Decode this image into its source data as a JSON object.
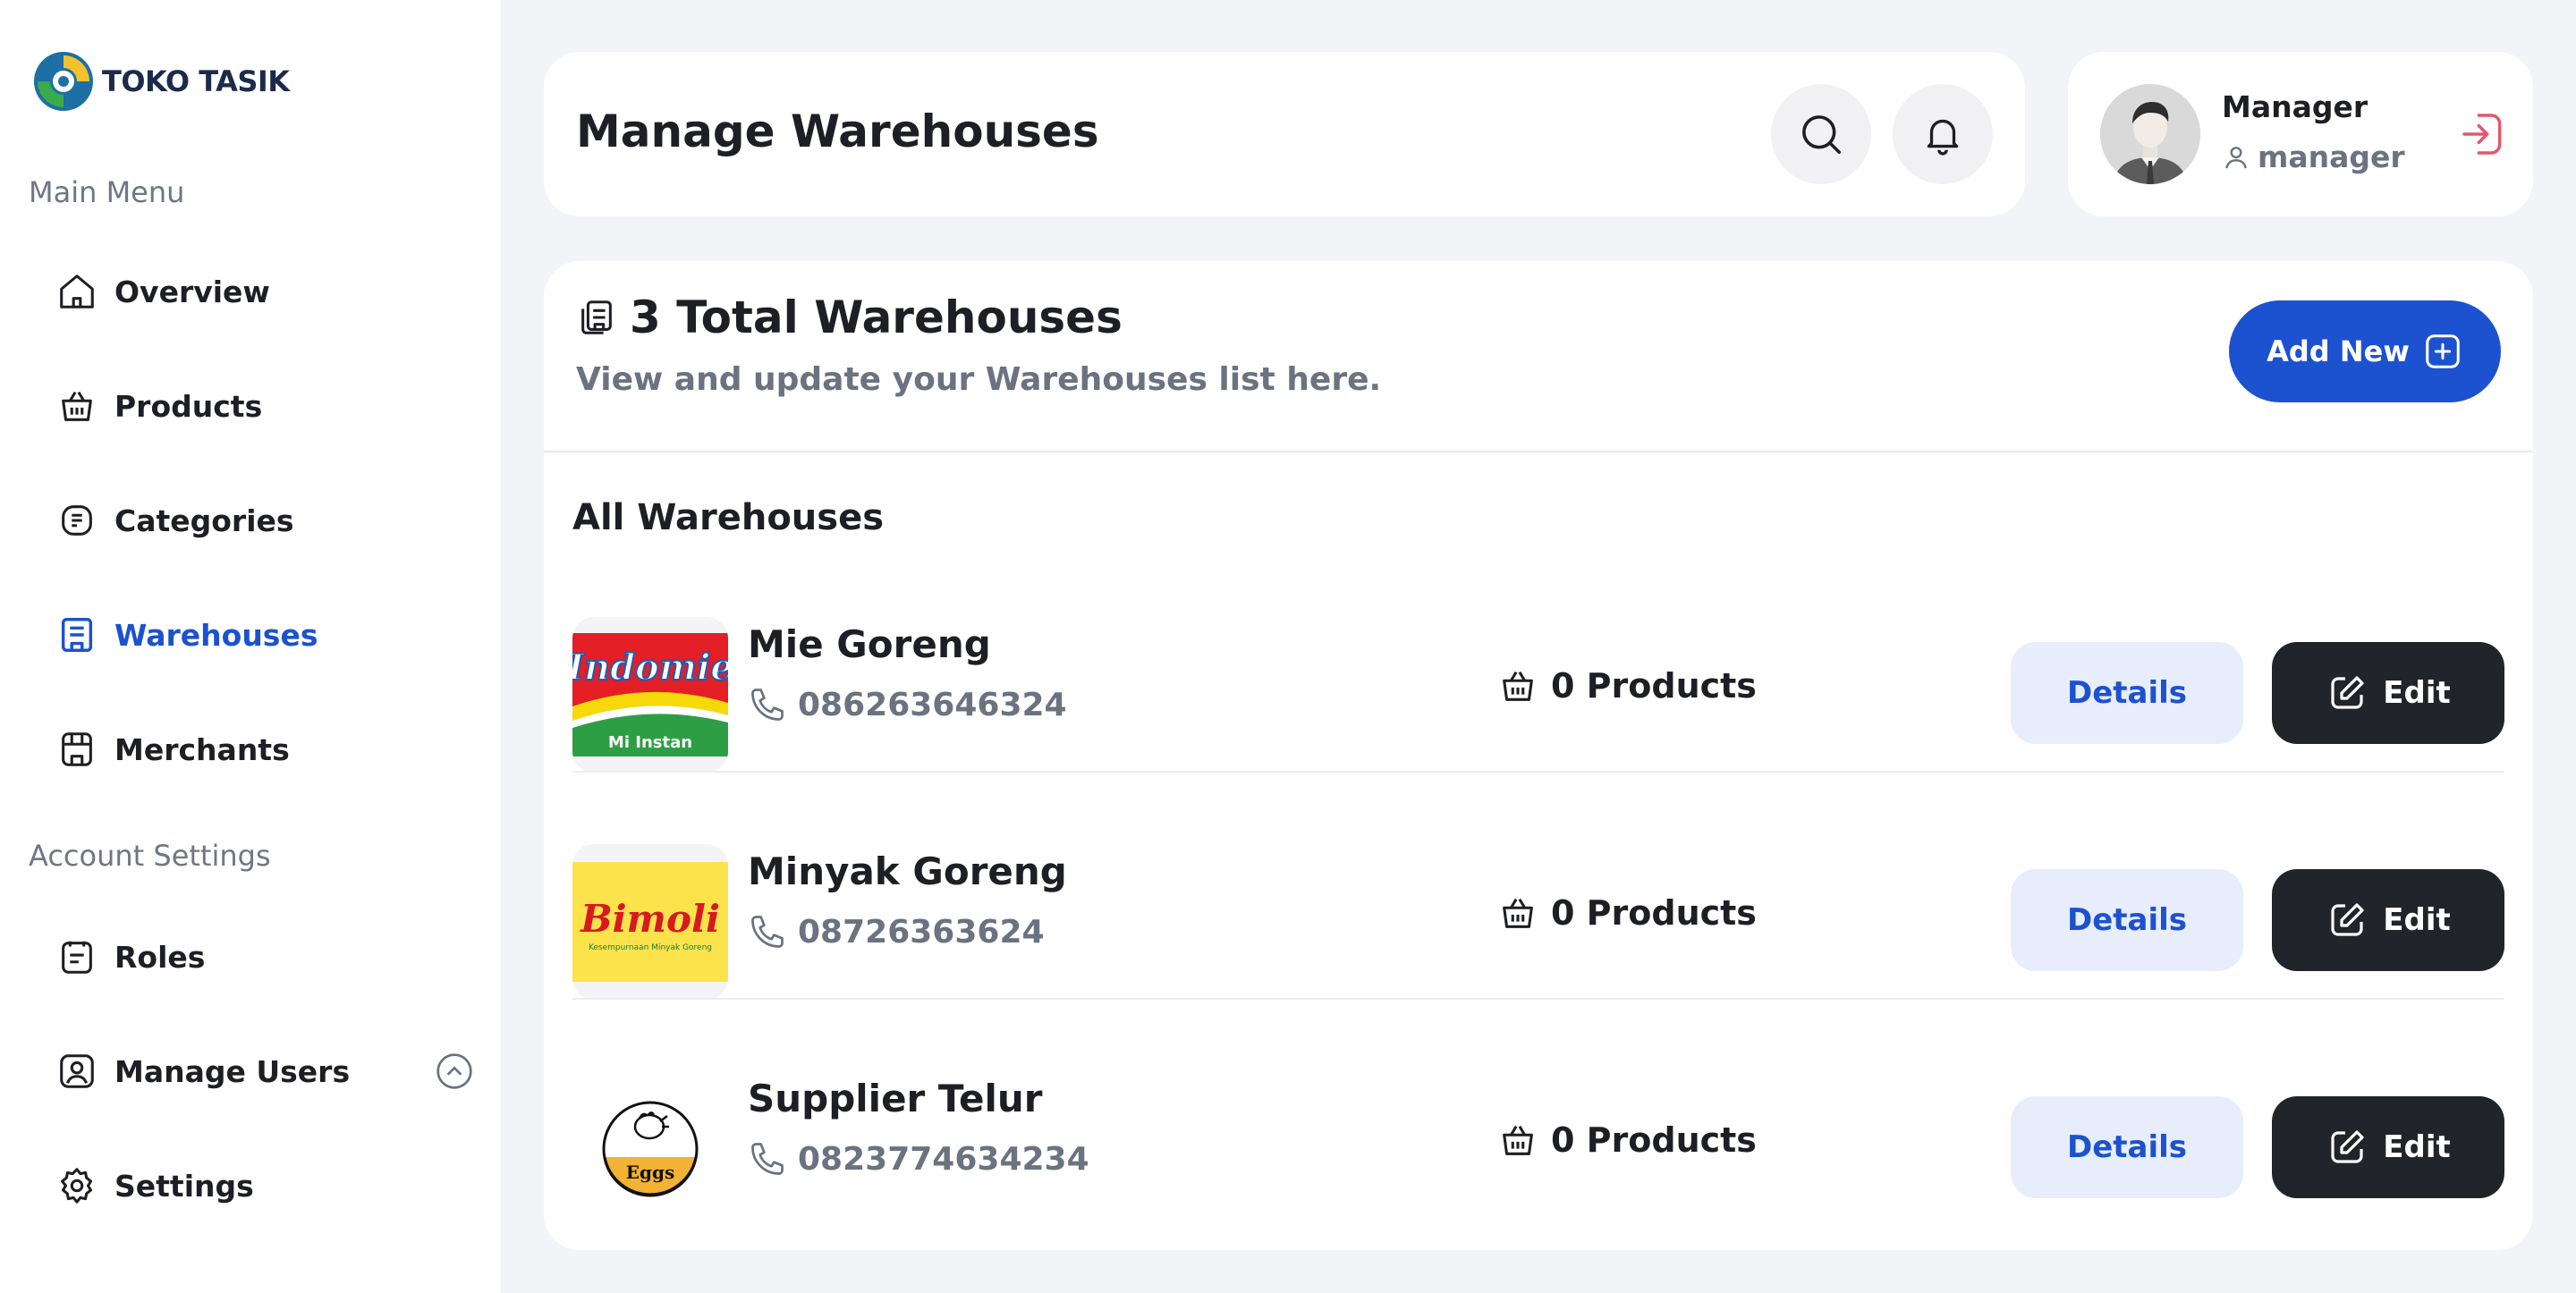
{
  "brand": {
    "name": "TOKO TASIK"
  },
  "sidebar": {
    "main_menu_title": "Main Menu",
    "account_settings_title": "Account Settings",
    "main_items": [
      {
        "label": "Overview",
        "icon": "home-icon"
      },
      {
        "label": "Products",
        "icon": "basket-icon"
      },
      {
        "label": "Categories",
        "icon": "category-icon"
      },
      {
        "label": "Warehouses",
        "icon": "warehouse-icon",
        "active": true
      },
      {
        "label": "Merchants",
        "icon": "store-icon"
      }
    ],
    "account_items": [
      {
        "label": "Roles",
        "icon": "roles-icon"
      },
      {
        "label": "Manage Users",
        "icon": "user-square-icon"
      },
      {
        "label": "Settings",
        "icon": "gear-icon"
      }
    ]
  },
  "header": {
    "title": "Manage Warehouses"
  },
  "user": {
    "name": "Manager",
    "role": "manager"
  },
  "summary": {
    "title": "3 Total Warehouses",
    "subtitle": "View and update your Warehouses list here.",
    "add_label": "Add New"
  },
  "list": {
    "title": "All Warehouses",
    "rows": [
      {
        "name": "Mie Goreng",
        "phone": "086263646324",
        "products": "0 Products",
        "details_label": "Details",
        "edit_label": "Edit",
        "thumb_text": "Indomie",
        "thumb_subtext": "Mi Instan"
      },
      {
        "name": "Minyak Goreng",
        "phone": "08726363624",
        "products": "0 Products",
        "details_label": "Details",
        "edit_label": "Edit",
        "thumb_text": "Bimoli",
        "thumb_subtext": "Kesempurnaan Minyak Goreng"
      },
      {
        "name": "Supplier Telur",
        "phone": "0823774634234",
        "products": "0 Products",
        "details_label": "Details",
        "edit_label": "Edit",
        "thumb_text": "Eggs"
      }
    ]
  },
  "colors": {
    "accent": "#1C52CF",
    "dark_button": "#212428",
    "logout": "#E5566B"
  }
}
